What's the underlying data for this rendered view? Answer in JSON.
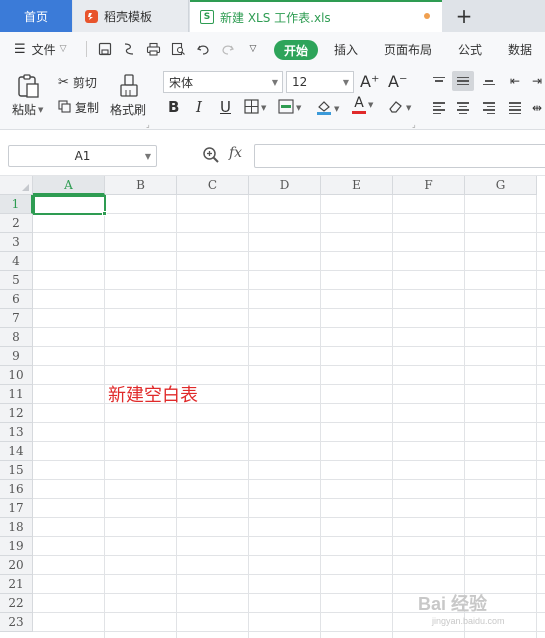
{
  "tabs": {
    "home": "首页",
    "template": "稻壳模板",
    "file": "新建 XLS 工作表.xls",
    "new_tab": "+"
  },
  "menu": {
    "file": "文件",
    "start": "开始",
    "insert": "插入",
    "page_layout": "页面布局",
    "formula": "公式",
    "data": "数据"
  },
  "ribbon": {
    "paste": "粘贴",
    "cut": "剪切",
    "copy": "复制",
    "format_painter": "格式刷",
    "font_name": "宋体",
    "font_size": "12",
    "bold": "B",
    "italic": "I",
    "underline": "U",
    "font_color_glyph": "A",
    "grow_font": "A⁺",
    "shrink_font": "A⁻"
  },
  "formula_bar": {
    "cell_ref": "A1",
    "fx": "fx",
    "value": ""
  },
  "grid": {
    "columns": [
      "A",
      "B",
      "C",
      "D",
      "E",
      "F",
      "G"
    ],
    "rows": [
      "1",
      "2",
      "3",
      "4",
      "5",
      "6",
      "7",
      "8",
      "9",
      "10",
      "11",
      "12",
      "13",
      "14",
      "15",
      "16",
      "17",
      "18",
      "19",
      "20",
      "21",
      "22",
      "23"
    ],
    "selected_column": "A",
    "selected_row": "1",
    "cell_text": "新建空白表"
  },
  "watermark": {
    "brand": "Bai 经验",
    "site": "jingyan.baidu.com"
  },
  "colors": {
    "accent_green": "#2e9c52",
    "home_tab_blue": "#3b7bd8",
    "cell_text_red": "#e02a2a"
  }
}
